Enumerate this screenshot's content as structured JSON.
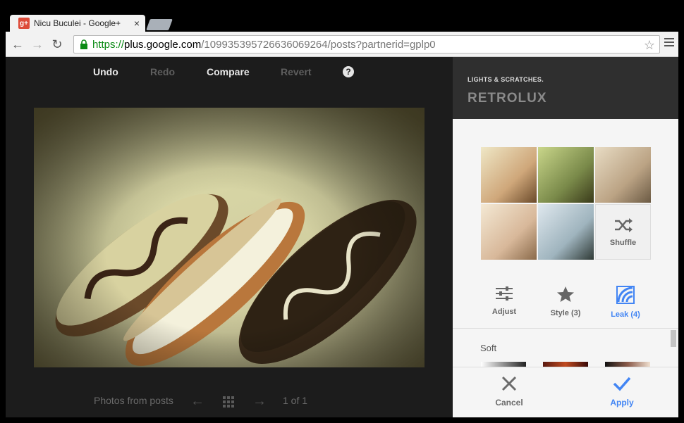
{
  "browser": {
    "tab_title": "Nicu Buculei - Google+",
    "favicon_text": "g+",
    "url_scheme": "https://",
    "url_host": "plus.google.com",
    "url_path": "/109935395726636069264/posts?partnerid=gplp0"
  },
  "editor": {
    "actions": {
      "undo": "Undo",
      "redo": "Redo",
      "compare": "Compare",
      "revert": "Revert",
      "help": "?"
    },
    "pager": {
      "photos_label": "Photos from posts",
      "page": "1 of 1"
    }
  },
  "panel": {
    "subtitle": "LIGHTS & SCRATCHES.",
    "filter_name": "RETROLUX",
    "shuffle_label": "Shuffle",
    "modes": {
      "adjust": "Adjust",
      "style": "Style (3)",
      "leak": "Leak (4)"
    },
    "section_label": "Soft",
    "cancel": "Cancel",
    "apply": "Apply"
  },
  "colors": {
    "accent": "#4285f4",
    "google_red": "#dd4b39",
    "panel_dark": "#2f2f2f"
  }
}
